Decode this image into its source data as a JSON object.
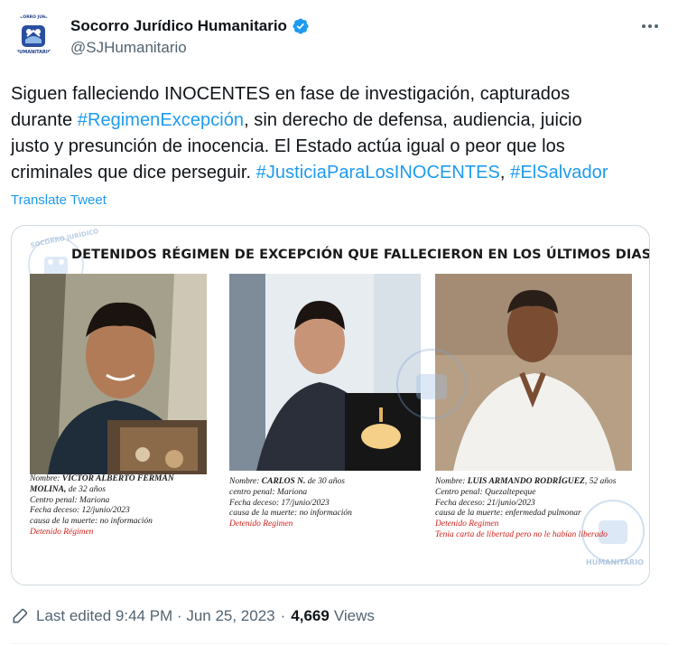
{
  "author": {
    "display_name": "Socorro Jurídico Humanitario",
    "handle": "@SJHumanitario",
    "avatar_label_top": "SOCORRO JURÍDICO",
    "avatar_label_bottom": "HUMANITARIO",
    "verified": true,
    "verified_color": "#1d9bf0"
  },
  "tweet": {
    "lines": [
      [
        {
          "t": "Siguen falleciendo INOCENTES en fase de investigación, capturados",
          "tag": false
        }
      ],
      [
        {
          "t": "durante ",
          "tag": false
        },
        {
          "t": "#RegimenExcepción",
          "tag": true
        },
        {
          "t": ", sin derecho de defensa, audiencia, juicio",
          "tag": false
        }
      ],
      [
        {
          "t": "justo y presunción de inocencia. El Estado actúa igual o peor que los",
          "tag": false
        }
      ],
      [
        {
          "t": "criminales que dice perseguir. ",
          "tag": false
        },
        {
          "t": "#JusticiaParaLosINOCENTES",
          "tag": true
        },
        {
          "t": ", ",
          "tag": false
        },
        {
          "t": "#ElSalvador",
          "tag": true
        }
      ]
    ],
    "translate_label": "Translate Tweet",
    "link_color": "#1d9bf0"
  },
  "media": {
    "title": "DETENIDOS RÉGIMEN DE EXCEPCIÓN QUE FALLECIERON EN LOS ÚLTIMOS DIAS",
    "watermark_top": "SOCORRO JURÍDICO",
    "watermark_bottom": "HUMANITARIO",
    "victims": [
      {
        "name_label": "Nombre: ",
        "name": "VÍCTOR ALBERTO FERMÁN",
        "name2": "MOLINA,",
        "age": " de 32 años",
        "prison": "Centro penal: Mariona",
        "death_date": "Fecha deceso: 12/junio/2023",
        "cause": "causa de la muerte: no información",
        "status": "Detenido Régimen",
        "note": ""
      },
      {
        "name_label": "Nombre: ",
        "name": "CARLOS N.",
        "name2": "",
        "age": " de 30 años",
        "prison": "centro penal: Mariona",
        "death_date": "Fecha deceso: 17/junio/2023",
        "cause": "causa de la muerte: no información",
        "status": "Detenido Regimen",
        "note": ""
      },
      {
        "name_label": "Nombre: ",
        "name": "LUIS ARMANDO RODRÍGUEZ",
        "name2": "",
        "age": ", 52 años",
        "prison": "Centro penal: Quezaltepeque",
        "death_date": "Fecha deceso: 21/junio/2023",
        "cause": "causa de la muerte: enfermedad pulmonar",
        "status": "Detenido Regimen",
        "note": "Tenia carta de libertad pero no le habían liberado"
      }
    ]
  },
  "footer": {
    "edited": "Last edited 9:44 PM · Jun 25, 2023",
    "separator": "·",
    "views_count": "4,669",
    "views_label": "Views"
  }
}
